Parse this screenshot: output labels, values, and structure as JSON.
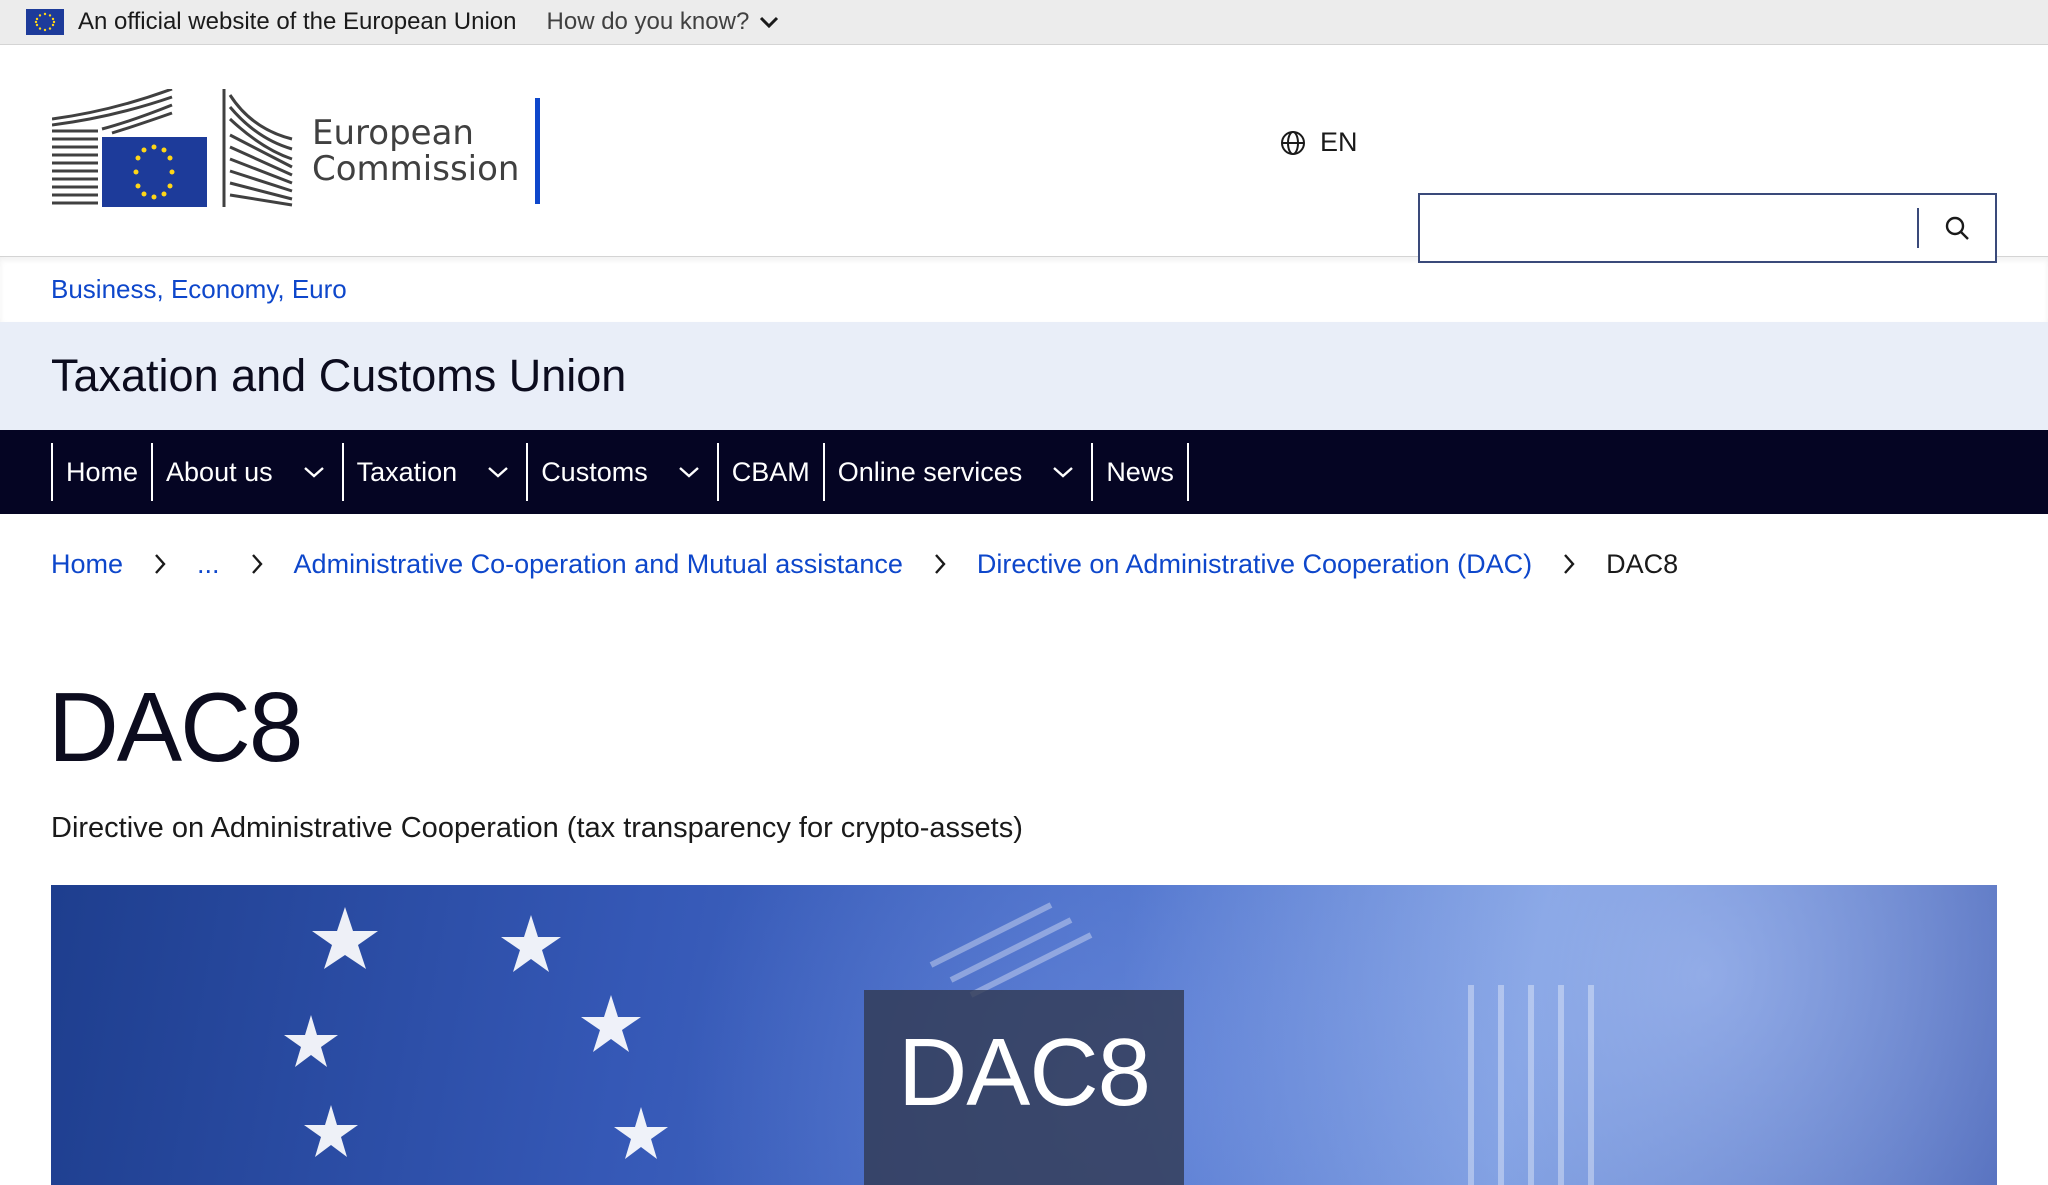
{
  "official_banner": {
    "text": "An official website of the European Union",
    "how_know": "How do you know?"
  },
  "header": {
    "logo_line1": "European",
    "logo_line2": "Commission",
    "language": "EN",
    "search_placeholder": ""
  },
  "site": {
    "context_link": "Business, Economy, Euro",
    "title": "Taxation and Customs Union"
  },
  "nav": {
    "items": [
      {
        "label": "Home"
      },
      {
        "label": "About us"
      },
      {
        "label": "Taxation"
      },
      {
        "label": "Customs"
      },
      {
        "label": "CBAM"
      },
      {
        "label": "Online services"
      },
      {
        "label": "News"
      }
    ]
  },
  "breadcrumb": {
    "items": [
      "Home",
      "...",
      "Administrative Co-operation and Mutual assistance",
      "Directive on Administrative Cooperation (DAC)",
      "DAC8"
    ]
  },
  "page": {
    "title": "DAC8",
    "description": "Directive on Administrative Cooperation (tax transparency for crypto-assets)",
    "hero_label": "DAC8"
  },
  "colors": {
    "link": "#0e47cb",
    "nav_bg": "#050523",
    "title_band": "#e9eef8"
  }
}
